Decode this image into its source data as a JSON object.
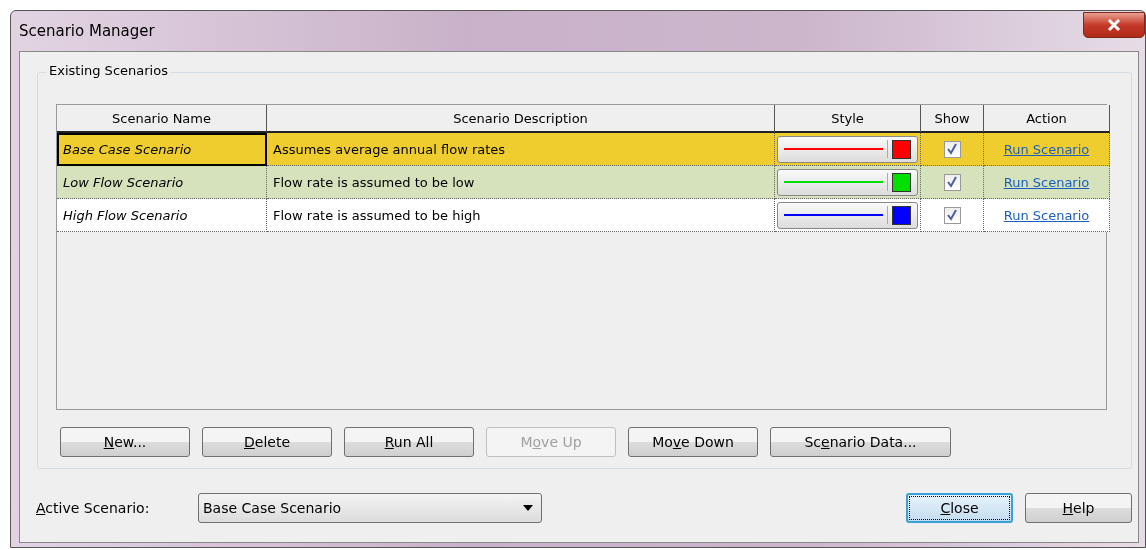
{
  "window": {
    "title": "Scenario Manager"
  },
  "group": {
    "title": "Existing Scenarios"
  },
  "table": {
    "columns": [
      "Scenario Name",
      "Scenario Description",
      "Style",
      "Show",
      "Action"
    ],
    "rows": [
      {
        "name": "Base Case Scenario",
        "description": "Assumes average annual flow rates",
        "color": "#ff0000",
        "show": true,
        "action": "Run Scenario",
        "selected": true
      },
      {
        "name": "Low Flow Scenario",
        "description": "Flow rate is assumed to be low",
        "color": "#00e000",
        "show": true,
        "action": "Run Scenario",
        "selected": false
      },
      {
        "name": "High Flow Scenario",
        "description": "Flow rate is assumed to be high",
        "color": "#0000ff",
        "show": true,
        "action": "Run Scenario",
        "selected": false
      }
    ]
  },
  "buttons": [
    {
      "access_key": "N",
      "label_after": "ew...",
      "disabled": false
    },
    {
      "access_key": "D",
      "label_after": "elete",
      "disabled": false
    },
    {
      "access_key": "R",
      "label_after": "un All",
      "disabled": false
    },
    {
      "label_before": "M",
      "access_key": "o",
      "label_after": "ve Up",
      "disabled": true
    },
    {
      "label_before": "Mo",
      "access_key": "v",
      "label_after": "e Down",
      "disabled": false
    },
    {
      "label_before": "Sc",
      "access_key": "e",
      "label_after": "nario Data...",
      "disabled": false
    }
  ],
  "active_scenario": {
    "access_key": "A",
    "label_after": "ctive Scenario:",
    "value": "Base Case Scenario"
  },
  "footer_buttons": [
    {
      "access_key": "C",
      "label_after": "lose",
      "focused": true
    },
    {
      "access_key": "H",
      "label_after": "elp",
      "focused": false
    }
  ]
}
